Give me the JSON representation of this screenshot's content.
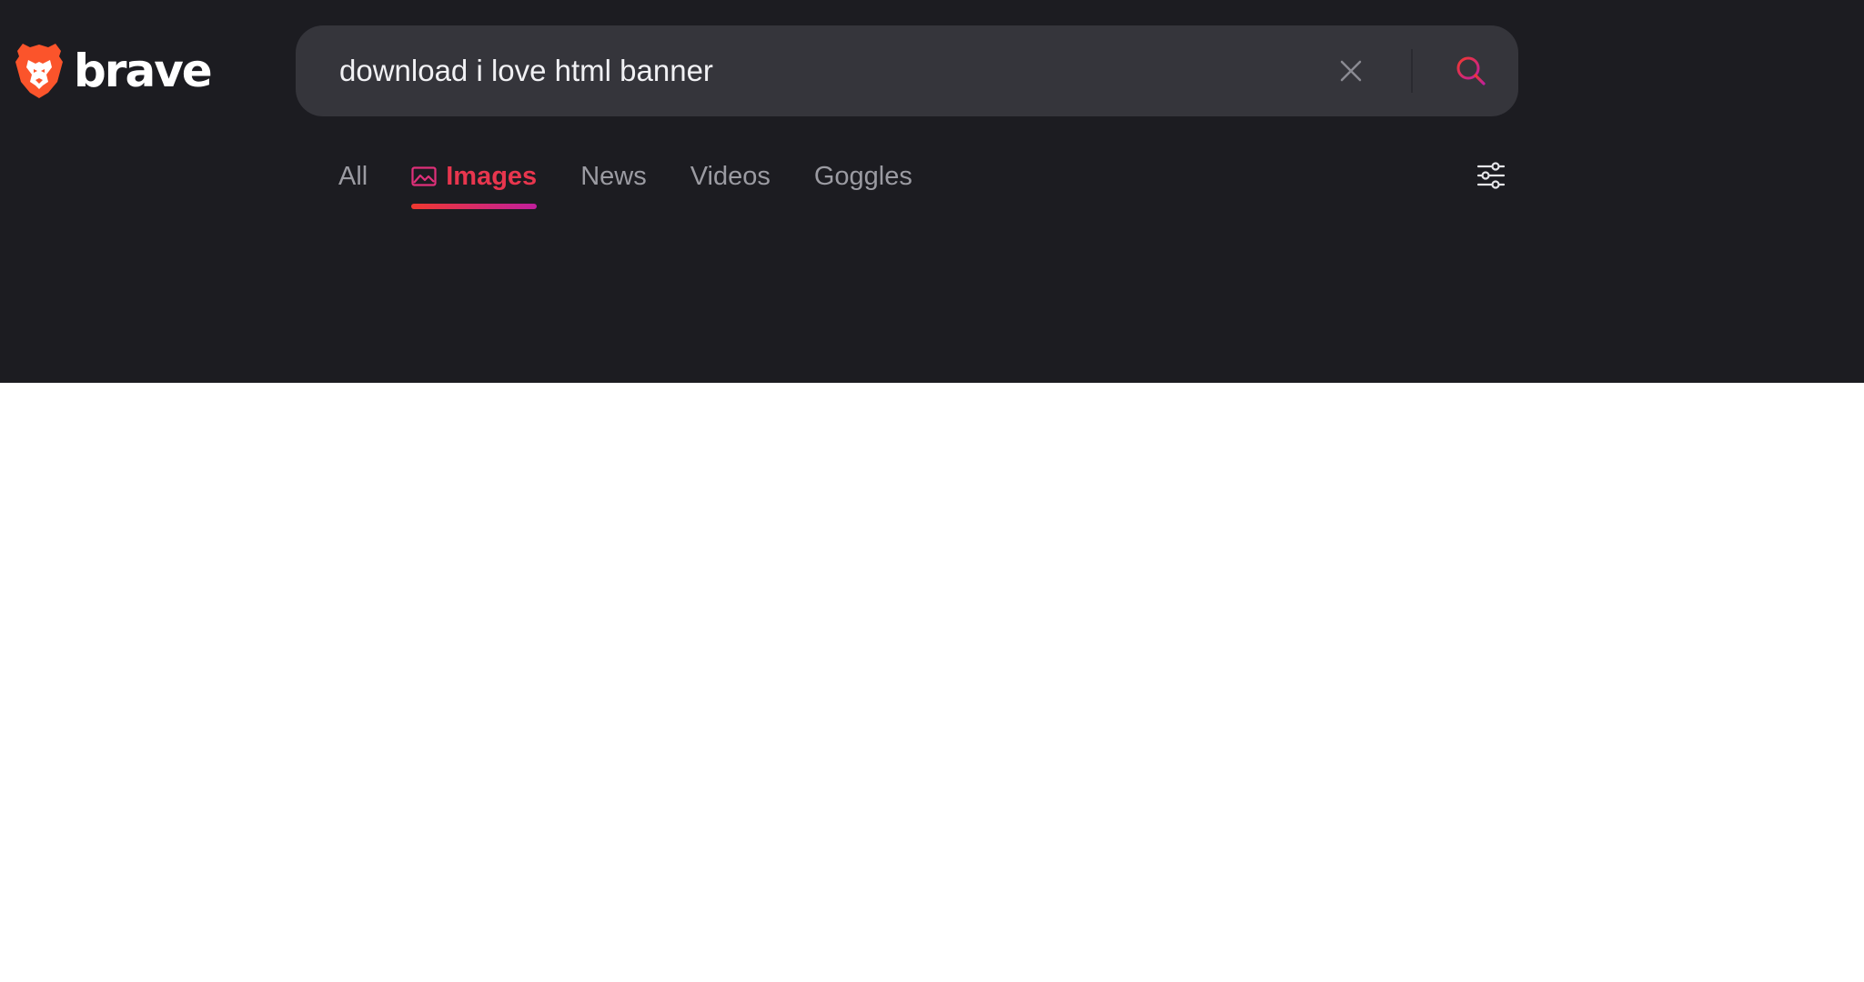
{
  "brand": {
    "name": "brave",
    "accent": "#fb542b"
  },
  "search": {
    "query": "download i love html banner",
    "clear_icon": "close-icon",
    "submit_icon": "search-icon"
  },
  "tabs": [
    {
      "label": "All",
      "active": false
    },
    {
      "label": "Images",
      "active": true,
      "icon": "image-icon"
    },
    {
      "label": "News",
      "active": false
    },
    {
      "label": "Videos",
      "active": false
    },
    {
      "label": "Goggles",
      "active": false
    }
  ],
  "filters": {
    "icon": "sliders-icon"
  },
  "colors": {
    "header_bg": "#1c1c21",
    "search_bg": "#35353b",
    "active_tab": "#e8364e",
    "inactive_tab": "#9b9ba2",
    "page_bg": "#ffffff"
  }
}
